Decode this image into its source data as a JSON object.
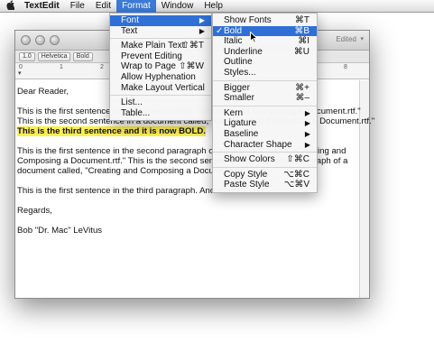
{
  "menubar": {
    "apple_icon": "",
    "items": [
      "TextEdit",
      "File",
      "Edit",
      "Format",
      "Window",
      "Help"
    ]
  },
  "window": {
    "status": "Edited",
    "toolbar": {
      "spacing": "1.0",
      "font": "Helvetica",
      "style": "Bold"
    },
    "ruler_numbers": [
      "0",
      "1",
      "2",
      "3",
      "4",
      "5",
      "6",
      "7",
      "8"
    ]
  },
  "document": {
    "lines": [
      "Dear Reader,",
      "",
      "This is the first sentence in a document called, \"Creating and Composing a Document.rtf.\"",
      "This is the second sentence in a document called, \"Creating and Composing a Document.rtf.\"",
      "This is the third sentence and it is now BOLD.",
      "",
      "This is the first sentence in the second paragraph of a document called, \"Creating and",
      "Composing a Document.rtf.\" This is the second sentence in the second paragraph of a",
      "document called, \"Creating and Composing a Document.rtf.\"",
      "",
      "This is the first  sentence in the third paragraph. And so on...",
      "",
      "Regards,",
      "",
      "Bob \"Dr. Mac\" LeVitus"
    ]
  },
  "format_menu": {
    "items": [
      {
        "label": "Font",
        "submenu": true
      },
      {
        "label": "Text",
        "submenu": true
      },
      {
        "sep": true
      },
      {
        "label": "Make Plain Text",
        "shortcut": "⇧⌘T"
      },
      {
        "label": "Prevent Editing"
      },
      {
        "label": "Wrap to Page",
        "shortcut": "⇧⌘W"
      },
      {
        "label": "Allow Hyphenation"
      },
      {
        "label": "Make Layout Vertical"
      },
      {
        "sep": true
      },
      {
        "label": "List..."
      },
      {
        "label": "Table..."
      }
    ]
  },
  "font_submenu": {
    "items": [
      {
        "label": "Show Fonts",
        "shortcut": "⌘T"
      },
      {
        "label": "Bold",
        "shortcut": "⌘B",
        "checked": true
      },
      {
        "label": "Italic",
        "shortcut": "⌘I"
      },
      {
        "label": "Underline",
        "shortcut": "⌘U"
      },
      {
        "label": "Outline"
      },
      {
        "label": "Styles..."
      },
      {
        "sep": true
      },
      {
        "label": "Bigger",
        "shortcut": "⌘+"
      },
      {
        "label": "Smaller",
        "shortcut": "⌘–"
      },
      {
        "sep": true
      },
      {
        "label": "Kern",
        "submenu": true
      },
      {
        "label": "Ligature",
        "submenu": true
      },
      {
        "label": "Baseline",
        "submenu": true
      },
      {
        "label": "Character Shape",
        "submenu": true
      },
      {
        "sep": true
      },
      {
        "label": "Show Colors",
        "shortcut": "⇧⌘C"
      },
      {
        "sep": true
      },
      {
        "label": "Copy Style",
        "shortcut": "⌥⌘C"
      },
      {
        "label": "Paste Style",
        "shortcut": "⌥⌘V"
      }
    ]
  },
  "glyphs": {
    "check": "✓",
    "arrow": "▶"
  },
  "colors": {
    "menu_highlight": "#2f6fd6",
    "text_highlight": "#fbee53"
  }
}
